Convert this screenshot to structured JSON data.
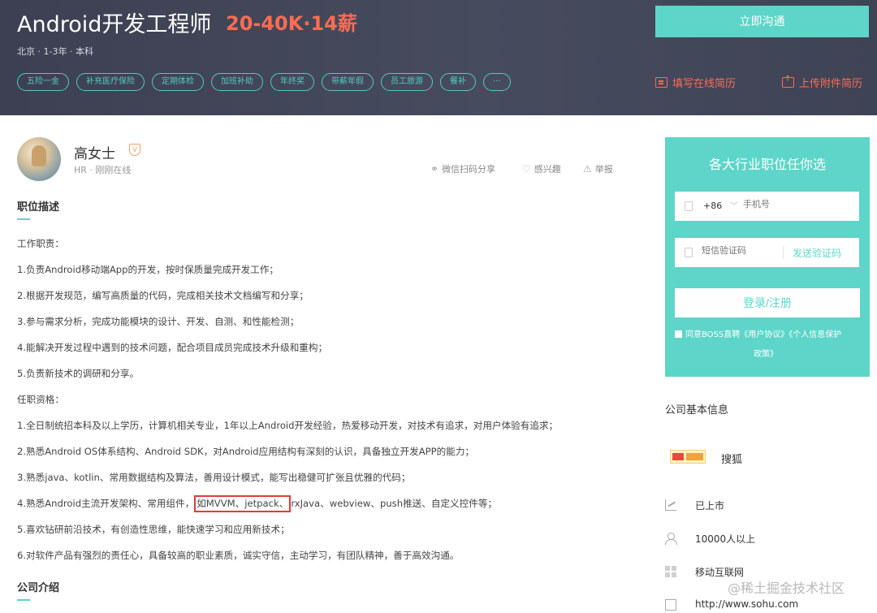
{
  "header": {
    "job_title": "Android开发工程师",
    "salary": "20-40K·14薪",
    "meta": "北京 · 1-3年 · 本科",
    "tags": [
      "五险一金",
      "补充医疗保险",
      "定期体检",
      "加班补助",
      "年终奖",
      "带薪年假",
      "员工旅游",
      "餐补",
      "···"
    ],
    "chat_button": "立即沟通",
    "fill_resume": "填写在线简历",
    "upload_resume": "上传附件简历",
    "accent_color": "#5dd5c8",
    "salary_color": "#fd6c52"
  },
  "recruiter": {
    "name": "高女士",
    "badge": "V",
    "meta": "HR · 刚刚在线",
    "share": "微信扫码分享",
    "interest": "感兴趣",
    "report": "举报"
  },
  "job_description": {
    "title": "职位描述",
    "duties_heading": "工作职责：",
    "duties": [
      "1.负责Android移动端App的开发，按时保质量完成开发工作；",
      "2.根据开发规范，编写高质量的代码，完成相关技术文档编写和分享；",
      "3.参与需求分析，完成功能模块的设计、开发、自测、和性能检测；",
      "4.能解决开发过程中遇到的技术问题，配合项目成员完成技术升级和重构；",
      "5.负责新技术的调研和分享。"
    ],
    "requirements_heading": "任职资格：",
    "requirements": [
      "1.全日制统招本科及以上学历，计算机相关专业，1年以上Android开发经验，热爱移动开发，对技术有追求，对用户体验有追求；",
      "2.熟悉Android OS体系结构、Android SDK，对Android应用结构有深刻的认识，具备独立开发APP的能力；",
      "3.熟悉java、kotlin、常用数据结构及算法，善用设计模式，能写出稳健可扩张且优雅的代码；"
    ],
    "req4_before": "4.熟悉Android主流开发架构、常用组件，",
    "req4_highlight": "如MVVM、jetpack、",
    "req4_after": "rxJava、webview、push推送、自定义控件等；",
    "requirements_tail": [
      "5.喜欢钻研前沿技术，有创造性思维，能快速学习和应用新技术；",
      "6.对软件产品有强烈的责任心，具备较高的职业素质，诚实守信，主动学习，有团队精神，善于高效沟通。"
    ],
    "company_intro_title": "公司介绍"
  },
  "login": {
    "title": "各大行业职位任你选",
    "country_code": "+86",
    "phone_placeholder": "手机号",
    "code_placeholder": "短信验证码",
    "send_code": "发送验证码",
    "submit": "登录/注册",
    "agreement_line1": "同意BOSS直聘《用户协议》《个人信息保护",
    "agreement_line2": "政策》"
  },
  "company": {
    "heading": "公司基本信息",
    "name": "搜狐",
    "stage": "已上市",
    "size": "10000人以上",
    "industry": "移动互联网",
    "website": "http://www.sohu.com"
  },
  "watermark": "@稀土掘金技术社区"
}
